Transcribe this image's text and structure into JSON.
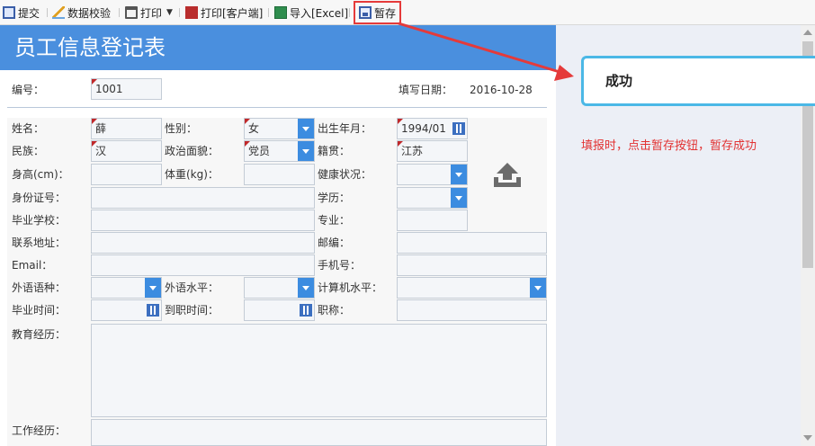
{
  "toolbar": {
    "submit": "提交",
    "verify": "数据校验",
    "print": "打印",
    "print_client": "打印[客户端]",
    "import_excel": "导入[Excel]",
    "save_draft": "暂存"
  },
  "form": {
    "title": "员工信息登记表",
    "number_label": "编号：",
    "number_value": "1001",
    "date_label": "填写日期：",
    "date_value": "2016-10-28",
    "fields": {
      "name_label": "姓名：",
      "name_value": "薛",
      "gender_label": "性别：",
      "gender_value": "女",
      "birth_label": "出生年月：",
      "birth_value": "1994/01",
      "ethnic_label": "民族：",
      "ethnic_value": "汉",
      "politics_label": "政治面貌：",
      "politics_value": "党员",
      "native_label": "籍贯：",
      "native_value": "江苏",
      "height_label": "身高(cm)：",
      "weight_label": "体重(kg)：",
      "health_label": "健康状况：",
      "id_label": "身份证号：",
      "edu_label": "学历：",
      "school_label": "毕业学校：",
      "major_label": "专业：",
      "address_label": "联系地址：",
      "zip_label": "邮编：",
      "email_label": "Email：",
      "phone_label": "手机号：",
      "lang_label": "外语语种：",
      "lang_level_label": "外语水平：",
      "computer_label": "计算机水平：",
      "grad_time_label": "毕业时间：",
      "join_time_label": "到职时间：",
      "title_label": "职称：",
      "edu_history_label": "教育经历：",
      "work_history_label": "工作经历："
    }
  },
  "toast": {
    "message": "成功"
  },
  "annotation": {
    "text": "填报时，点击暂存按钮，暂存成功",
    "color": "#e23232"
  },
  "colors": {
    "banner": "#4a8fde",
    "accent": "#3c8ce0",
    "highlight": "#e53a3a",
    "toast_border": "#4bb8e6"
  },
  "icons": [
    "save-icon",
    "verify-icon",
    "print-icon",
    "pdf-icon",
    "excel-icon",
    "draft-save-icon",
    "upload-icon",
    "calendar-icon",
    "chevron-down-icon"
  ]
}
